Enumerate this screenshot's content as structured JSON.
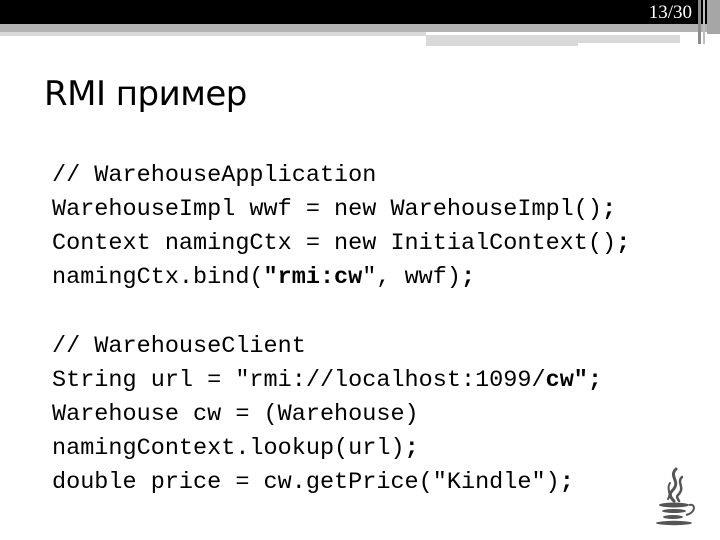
{
  "slide": {
    "page_indicator": "13/30",
    "title": "RMI пример",
    "logo_icon": "java-coffee-cup-icon"
  },
  "code_blocks": [
    {
      "name": "server",
      "lines": [
        {
          "segments": [
            {
              "text": "// WarehouseApplication",
              "bold": false
            }
          ]
        },
        {
          "segments": [
            {
              "text": "WarehouseImpl wwf = new WarehouseImpl()",
              "bold": false
            },
            {
              "text": ";",
              "bold": true
            }
          ]
        },
        {
          "segments": [
            {
              "text": "Context namingCtx = new InitialContext()",
              "bold": false
            },
            {
              "text": ";",
              "bold": true
            }
          ]
        },
        {
          "segments": [
            {
              "text": "namingCtx.bind(",
              "bold": false
            },
            {
              "text": "\"rmi:cw",
              "bold": true
            },
            {
              "text": "\", wwf)",
              "bold": false
            },
            {
              "text": ";",
              "bold": true
            }
          ]
        }
      ]
    },
    {
      "name": "client",
      "lines": [
        {
          "segments": [
            {
              "text": "// WarehouseClient",
              "bold": false
            }
          ]
        },
        {
          "segments": [
            {
              "text": "String url = \"rmi://localhost:1099/",
              "bold": false
            },
            {
              "text": "cw\";",
              "bold": true
            }
          ]
        },
        {
          "segments": [
            {
              "text": "Warehouse cw = (Warehouse)",
              "bold": false
            }
          ]
        },
        {
          "segments": [
            {
              "text": "namingContext.lookup(url)",
              "bold": false
            },
            {
              "text": ";",
              "bold": true
            }
          ]
        },
        {
          "segments": [
            {
              "text": "double price = cw.getPrice(\"Kindle\")",
              "bold": false
            },
            {
              "text": ";",
              "bold": true
            }
          ]
        }
      ]
    }
  ]
}
